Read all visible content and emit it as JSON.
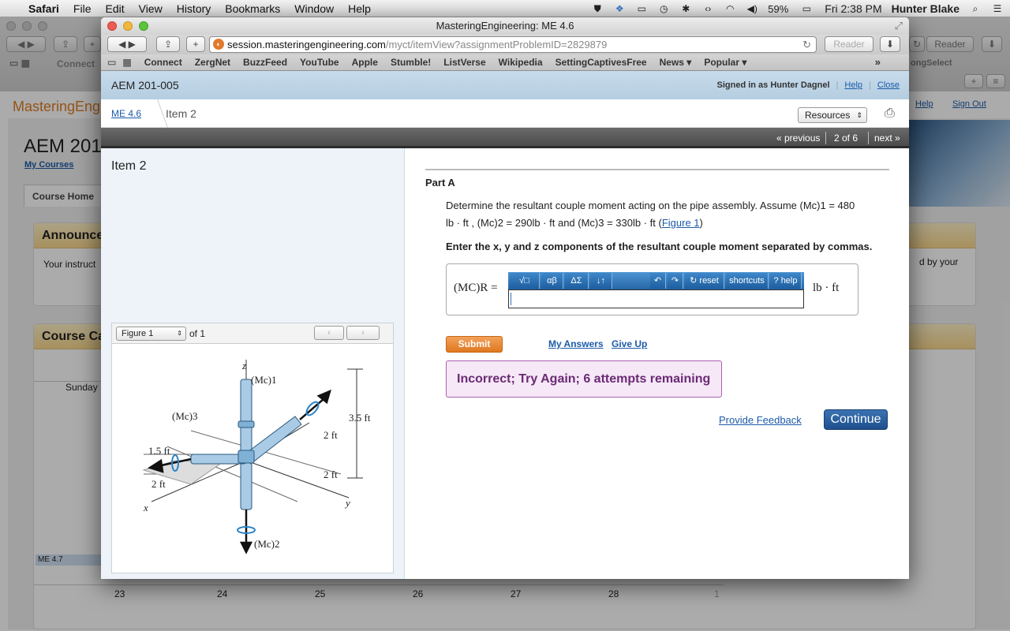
{
  "menubar": {
    "app_name": "Safari",
    "menus": [
      "File",
      "Edit",
      "View",
      "History",
      "Bookmarks",
      "Window",
      "Help"
    ],
    "battery": "59%",
    "clock": "Fri 2:38 PM",
    "user": "Hunter Blake"
  },
  "background": {
    "bookmark_connect": "Connect",
    "bookmark_right": "ongSelect",
    "reader": "Reader",
    "logo": "MasteringEngi",
    "course_title": "AEM 201",
    "my_courses": "My Courses",
    "help": "Help",
    "sign_out": "Sign Out",
    "tab_course_home": "Course Home",
    "announce_title": "Announce",
    "announce_text": "Your instruct",
    "announce_right_text": "d by your",
    "calendar_title": "Course Ca",
    "sunday": "Sunday",
    "me47": "ME 4.7",
    "days": [
      "23",
      "24",
      "25",
      "26",
      "27",
      "28",
      "1"
    ]
  },
  "window": {
    "title": "MasteringEngineering: ME 4.6",
    "url_host": "session.masteringengineering.com",
    "url_path": "/myct/itemView?assignmentProblemID=2829879",
    "reader": "Reader",
    "bookmarks": [
      "Connect",
      "ZergNet",
      "BuzzFeed",
      "YouTube",
      "Apple",
      "Stumble!",
      "ListVerse",
      "Wikipedia",
      "SettingCaptivesFree",
      "News ▾",
      "Popular ▾"
    ]
  },
  "header": {
    "course": "AEM 201-005",
    "signed_in": "Signed in as Hunter Dagnel",
    "help": "Help",
    "close": "Close"
  },
  "crumbs": {
    "assignment": "ME 4.6",
    "item": "Item 2",
    "resources": "Resources"
  },
  "nav": {
    "previous": "« previous",
    "position": "2 of 6",
    "next": "next »"
  },
  "left": {
    "item_title": "Item 2",
    "figure_select": "Figure 1",
    "figure_of": "of 1"
  },
  "figure": {
    "z": "z",
    "x": "x",
    "y": "y",
    "mc1": "(Mc)1",
    "mc2": "(Mc)2",
    "mc3": "(Mc)3",
    "d1": "1.5 ft",
    "d2": "2 ft",
    "d3": "2 ft",
    "d4": "2 ft",
    "d5": "3.5 ft"
  },
  "question": {
    "part": "Part A",
    "prompt_1": "Determine the resultant couple moment acting on the pipe assembly. Assume (Mc)1 = 480",
    "prompt_2a": "lb · ft , (Mc)2 = 290lb · ft and (Mc)3 = 330lb · ft (",
    "figure_link": "Figure 1",
    "prompt_2b": ")",
    "instruction": "Enter the x, y and z components of the resultant couple moment separated by commas.",
    "answer_label": "(MC)R =",
    "answer_value": "",
    "unit": "lb · ft",
    "tools": [
      "√□",
      "αβ",
      "ΔΣ",
      "↓↑"
    ],
    "reset": "reset",
    "shortcuts": "shortcuts",
    "help": "help",
    "submit": "Submit",
    "my_answers": "My Answers",
    "give_up": "Give Up",
    "feedback": "Incorrect; Try Again; 6 attempts remaining",
    "provide_feedback": "Provide Feedback",
    "continue": "Continue"
  }
}
